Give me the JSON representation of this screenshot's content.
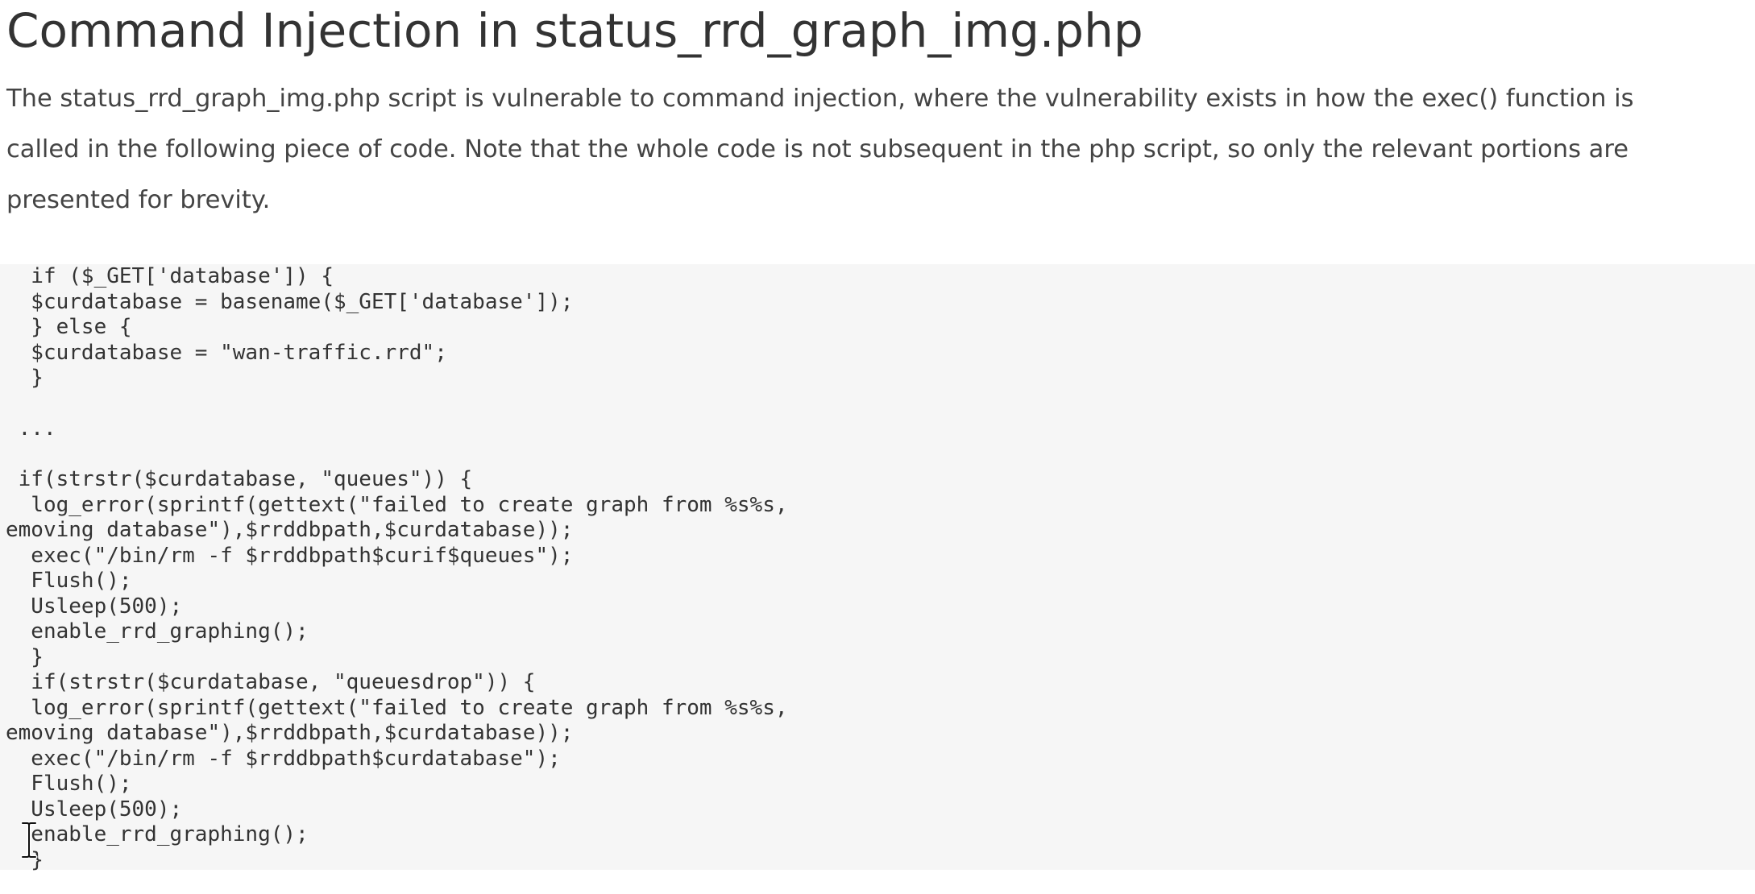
{
  "article": {
    "title": "Command Injection in status_rrd_graph_img.php",
    "intro_lines": [
      "The status_rrd_graph_img.php script is vulnerable to command injection, where the vulnerability exists in how the exec() function is",
      "called in the following piece of code. Note that the whole code is not subsequent in the php script, so only the relevant portions are",
      "presented for brevity."
    ],
    "code_lines": [
      "  if ($_GET['database']) {",
      "  $curdatabase = basename($_GET['database']);",
      "  } else {",
      "  $curdatabase = \"wan-traffic.rrd\";",
      "  }",
      "",
      " ...",
      "",
      " if(strstr($curdatabase, \"queues\")) {",
      "  log_error(sprintf(gettext(\"failed to create graph from %s%s,",
      "emoving database\"),$rrddbpath,$curdatabase));",
      "  exec(\"/bin/rm -f $rrddbpath$curif$queues\");",
      "  Flush();",
      "  Usleep(500);",
      "  enable_rrd_graphing();",
      "  }",
      "  if(strstr($curdatabase, \"queuesdrop\")) {",
      "  log_error(sprintf(gettext(\"failed to create graph from %s%s,",
      "emoving database\"),$rrddbpath,$curdatabase));",
      "  exec(\"/bin/rm -f $rrddbpath$curdatabase\");",
      "  Flush();",
      "  Usleep(500);",
      "  enable_rrd_graphing();",
      "  }"
    ]
  },
  "cursor": {
    "icon": "text-cursor-icon"
  }
}
